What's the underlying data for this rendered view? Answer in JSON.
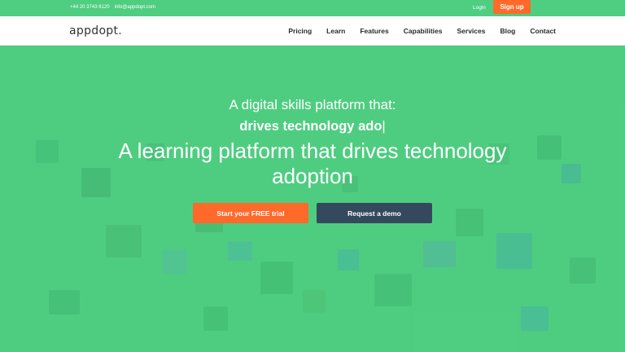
{
  "topbar": {
    "phone": "+44 20 3743 6120",
    "email": "info@appdopt.com",
    "login_label": "Login",
    "signup_label": "Sign up"
  },
  "nav": {
    "logo_text": "appdopt.",
    "links": [
      "Pricing",
      "Learn",
      "Features",
      "Capabilities",
      "Services",
      "Blog",
      "Contact"
    ]
  },
  "hero": {
    "line1": "A digital skills platform that:",
    "line2": "drives technology ado",
    "cursor": "|",
    "line3": "A learning platform that drives technology adoption",
    "cta_primary": "Start your FREE trial",
    "cta_secondary": "Request a demo"
  },
  "colors": {
    "brand_green": "#4fcd80",
    "accent_orange": "#ff6a2b",
    "dark_slate": "#34495e"
  }
}
